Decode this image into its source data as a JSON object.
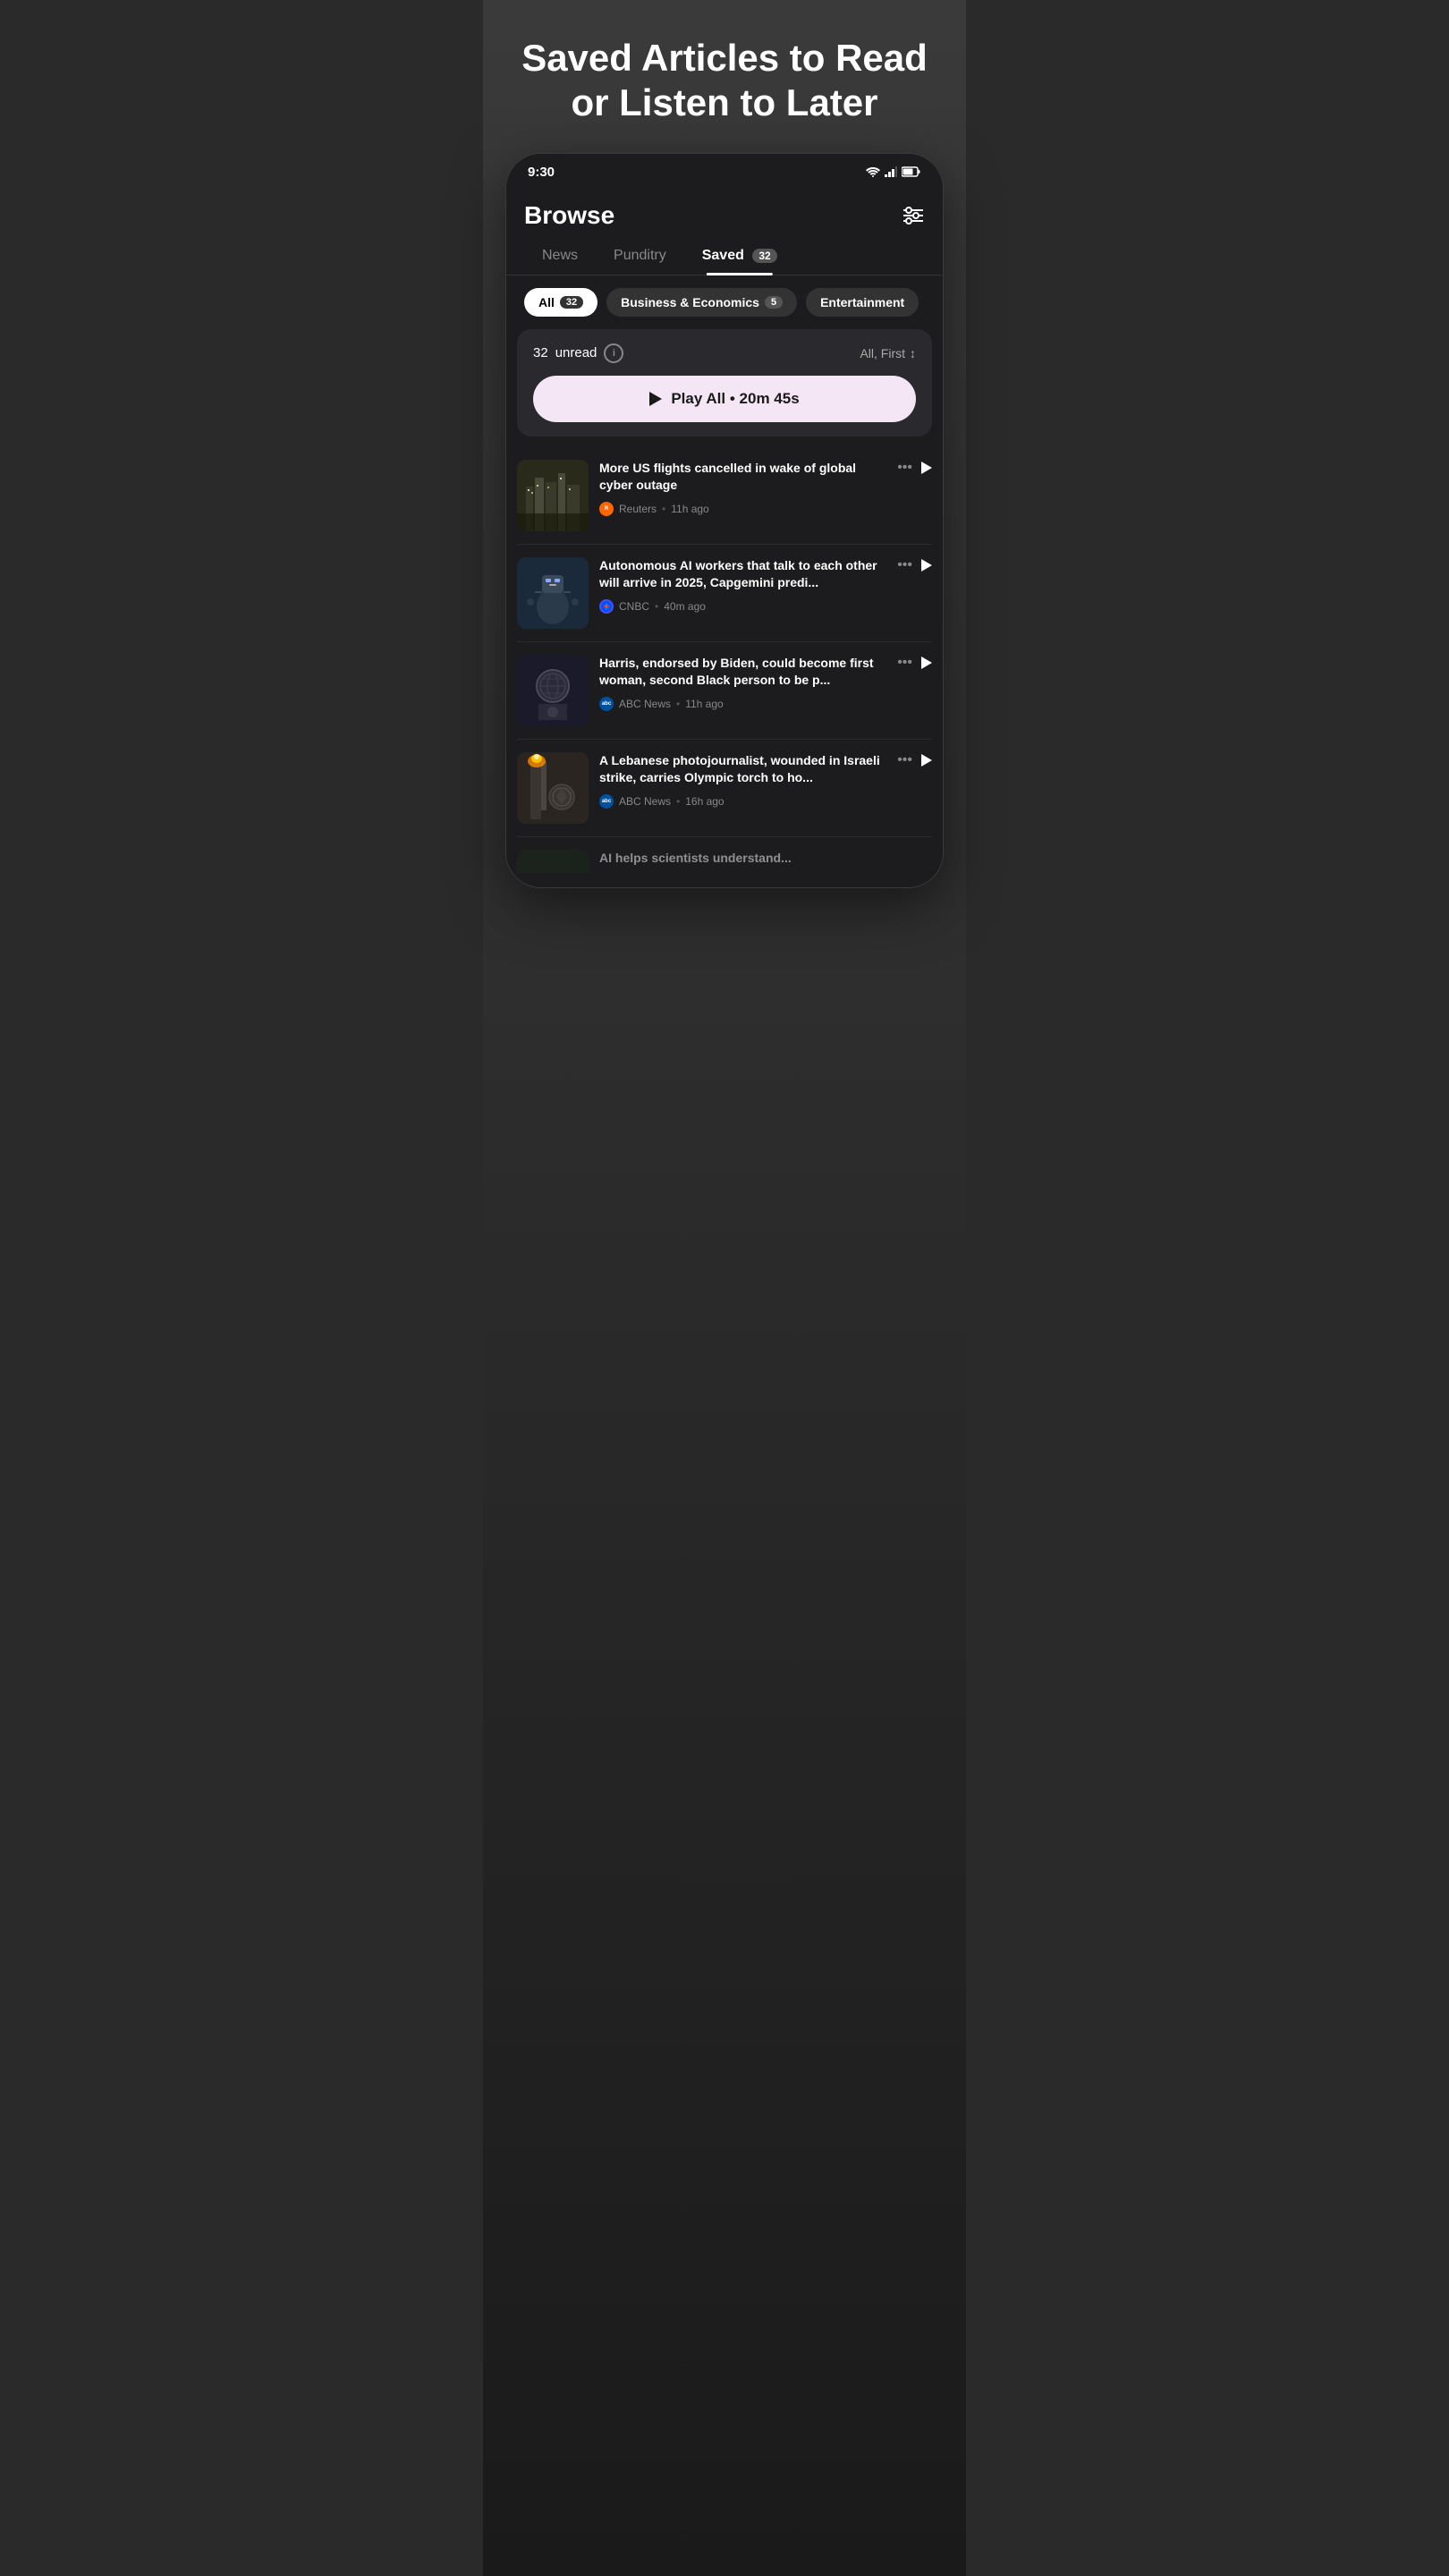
{
  "hero": {
    "title": "Saved Articles to Read or Listen to Later"
  },
  "statusBar": {
    "time": "9:30",
    "wifi": "▲",
    "signal": "▲",
    "battery": "▮"
  },
  "header": {
    "title": "Browse",
    "filterIcon": "≡"
  },
  "tabs": [
    {
      "id": "news",
      "label": "News",
      "active": false,
      "badge": null
    },
    {
      "id": "punditry",
      "label": "Punditry",
      "active": false,
      "badge": null
    },
    {
      "id": "saved",
      "label": "Saved",
      "active": true,
      "badge": "32"
    }
  ],
  "filterChips": [
    {
      "id": "all",
      "label": "All",
      "badge": "32",
      "active": true
    },
    {
      "id": "business",
      "label": "Business & Economics",
      "badge": "5",
      "active": false
    },
    {
      "id": "entertainment",
      "label": "Entertainment",
      "badge": null,
      "active": false
    }
  ],
  "unreadSection": {
    "count": "32",
    "unreadLabel": "unread",
    "sortLabel": "All, First",
    "sortIcon": "↕",
    "playAllLabel": "Play All",
    "playDuration": "20m 45s"
  },
  "articles": [
    {
      "title": "More US flights cancelled in wake of global cyber outage",
      "source": "Reuters",
      "sourceType": "reuters",
      "timeAgo": "11h ago"
    },
    {
      "title": "Autonomous AI workers that talk to each other will arrive in 2025, Capgemini predi...",
      "source": "CNBC",
      "sourceType": "cnbc",
      "timeAgo": "40m ago"
    },
    {
      "title": "Harris, endorsed by Biden, could become first woman, second Black person to be p...",
      "source": "ABC News",
      "sourceType": "abc",
      "timeAgo": "11h ago"
    },
    {
      "title": "A Lebanese photojournalist, wounded in Israeli strike, carries Olympic torch to ho...",
      "source": "ABC News",
      "sourceType": "abc",
      "timeAgo": "16h ago"
    }
  ]
}
